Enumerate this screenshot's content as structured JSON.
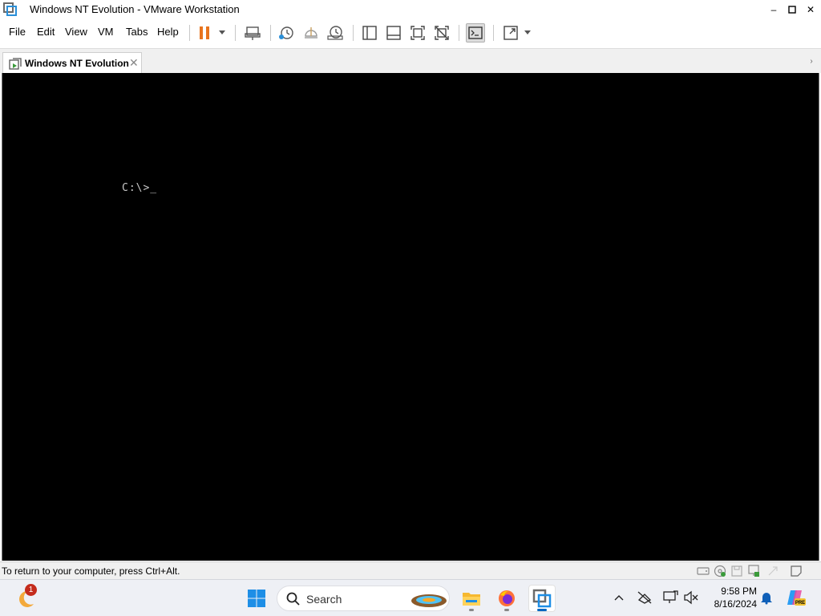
{
  "window": {
    "title": "Windows NT Evolution - VMware Workstation",
    "minimize": "–",
    "maximize": "▢",
    "close": "✕"
  },
  "menu": {
    "file": "File",
    "edit": "Edit",
    "view": "View",
    "vm": "VM",
    "tabs": "Tabs",
    "help": "Help"
  },
  "toolbar": {
    "icons": [
      "pause-icon",
      "send-ctrl-alt-del-icon",
      "snapshot-icon",
      "revert-snapshot-icon",
      "snapshot-manager-icon",
      "library-icon",
      "thumbnail-bar-icon",
      "full-screen-icon",
      "unity-icon",
      "console-view-icon",
      "stretch-guest-icon"
    ],
    "accent": "#e8741e"
  },
  "tabs": [
    {
      "label": "Windows NT Evolution",
      "close": "✕"
    }
  ],
  "console": {
    "prompt": "C:\\>_",
    "background": "#000000",
    "text_color": "#c8c8c8"
  },
  "statusbar": {
    "message": "To return to your computer, press Ctrl+Alt.",
    "devices": [
      "hard-disk-icon",
      "cd-rom-icon",
      "floppy-icon",
      "network-adapter-icon",
      "usb-icon",
      "message-log-icon"
    ]
  },
  "taskbar": {
    "weather_badge": "1",
    "search_placeholder": "Search",
    "apps": [
      "windows-start-icon",
      "search-box",
      "file-explorer-icon",
      "firefox-icon",
      "vmware-workstation-icon"
    ],
    "tray": [
      "show-hidden-icons-chevron",
      "network-offline-icon",
      "display-icon",
      "speaker-muted-icon",
      "notification-bell-icon",
      "copilot-icon"
    ],
    "time": "9:58 PM",
    "date": "8/16/2024",
    "copilot_label": "PRE"
  }
}
